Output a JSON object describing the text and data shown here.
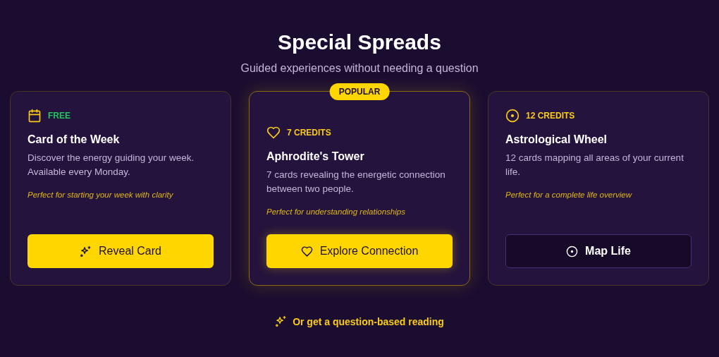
{
  "header": {
    "title": "Special Spreads",
    "subtitle": "Guided experiences without needing a question"
  },
  "cards": [
    {
      "price": "FREE",
      "color": "#22c55e",
      "title": "Card of the Week",
      "description": "Discover the energy guiding your week. Available every Monday.",
      "note": "Perfect for starting your week with clarity",
      "featured": false,
      "button": {
        "label": "Reveal Card",
        "kind": "primary"
      }
    },
    {
      "badge": "POPULAR",
      "price": "7 CREDITS",
      "color": "#facc15",
      "title": "Aphrodite's Tower",
      "description": "7 cards revealing the energetic connection between two people.",
      "note": "Perfect for understanding relationships",
      "featured": true,
      "button": {
        "label": "Explore Connection",
        "kind": "primary"
      }
    },
    {
      "price": "12 CREDITS",
      "color": "#facc15",
      "title": "Astrological Wheel",
      "description": "12 cards mapping all areas of your current life.",
      "note": "Perfect for a complete life overview",
      "featured": false,
      "button": {
        "label": "Map Life",
        "kind": "outline"
      }
    }
  ],
  "footer_link": {
    "label": "Or get a question-based reading"
  }
}
